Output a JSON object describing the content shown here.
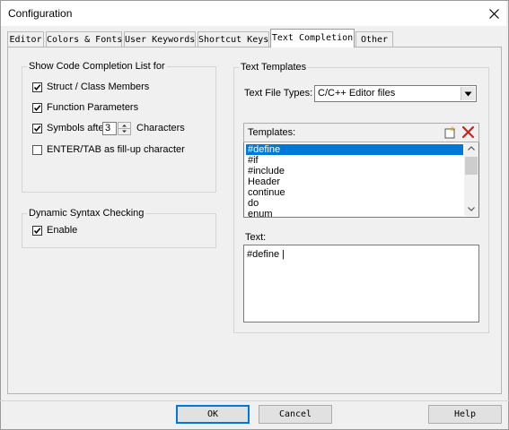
{
  "window": {
    "title": "Configuration"
  },
  "tabs": [
    {
      "label": "Editor"
    },
    {
      "label": "Colors & Fonts"
    },
    {
      "label": "User Keywords"
    },
    {
      "label": "Shortcut Keys"
    },
    {
      "label": "Text Completion",
      "active": true
    },
    {
      "label": "Other"
    }
  ],
  "code_completion": {
    "group_label": "Show Code Completion List for",
    "struct_members": {
      "label": "Struct / Class Members",
      "checked": true
    },
    "function_params": {
      "label": "Function Parameters",
      "checked": true
    },
    "symbols_after": {
      "label": "Symbols after",
      "checked": true,
      "value": "3",
      "suffix": "Characters"
    },
    "enter_tab": {
      "label": "ENTER/TAB as fill-up character",
      "checked": false
    }
  },
  "syntax_checking": {
    "group_label": "Dynamic Syntax Checking",
    "enable": {
      "label": "Enable",
      "checked": true
    }
  },
  "text_templates": {
    "group_label": "Text Templates",
    "file_types_label": "Text File Types:",
    "file_types_value": "C/C++ Editor files",
    "templates_label": "Templates:",
    "templates": [
      "#define",
      "#if",
      "#include",
      "Header",
      "continue",
      "do",
      "enum"
    ],
    "selected_index": 0,
    "text_label": "Text:",
    "text_value": "#define |"
  },
  "buttons": {
    "ok": "OK",
    "cancel": "Cancel",
    "help": "Help"
  },
  "colors": {
    "accent": "#0078d7",
    "new_icon": "#e8a317",
    "delete_icon": "#d0201a"
  }
}
